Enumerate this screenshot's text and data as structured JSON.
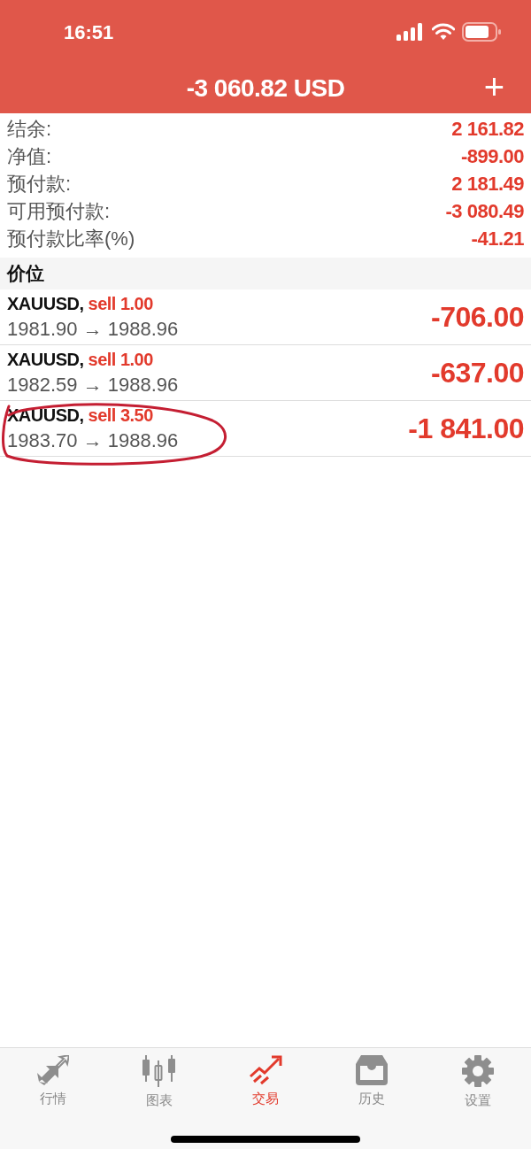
{
  "status_bar": {
    "time": "16:51"
  },
  "header": {
    "title": "-3 060.82 USD",
    "add_button": "+"
  },
  "summary": [
    {
      "label": "结余:",
      "value": "2 161.82"
    },
    {
      "label": "净值:",
      "value": "-899.00"
    },
    {
      "label": "预付款:",
      "value": "2 181.49"
    },
    {
      "label": "可用预付款:",
      "value": "-3 080.49"
    },
    {
      "label": "预付款比率(%)",
      "value": "-41.21"
    }
  ],
  "section_title": "价位",
  "positions": [
    {
      "symbol": "XAUUSD,",
      "order": "sell 1.00",
      "prices": "1981.90 → 1988.96",
      "profit": "-706.00",
      "circled": false
    },
    {
      "symbol": "XAUUSD,",
      "order": "sell 1.00",
      "prices": "1982.59 → 1988.96",
      "profit": "-637.00",
      "circled": false
    },
    {
      "symbol": "XAUUSD,",
      "order": "sell 3.50",
      "prices": "1983.70 → 1988.96",
      "profit": "-1 841.00",
      "circled": true
    }
  ],
  "tabs": [
    {
      "label": "行情",
      "kind": "quotes",
      "selected": false
    },
    {
      "label": "图表",
      "kind": "chart",
      "selected": false
    },
    {
      "label": "交易",
      "kind": "trade",
      "selected": true
    },
    {
      "label": "历史",
      "kind": "history",
      "selected": false
    },
    {
      "label": "设置",
      "kind": "settings",
      "selected": false
    }
  ]
}
